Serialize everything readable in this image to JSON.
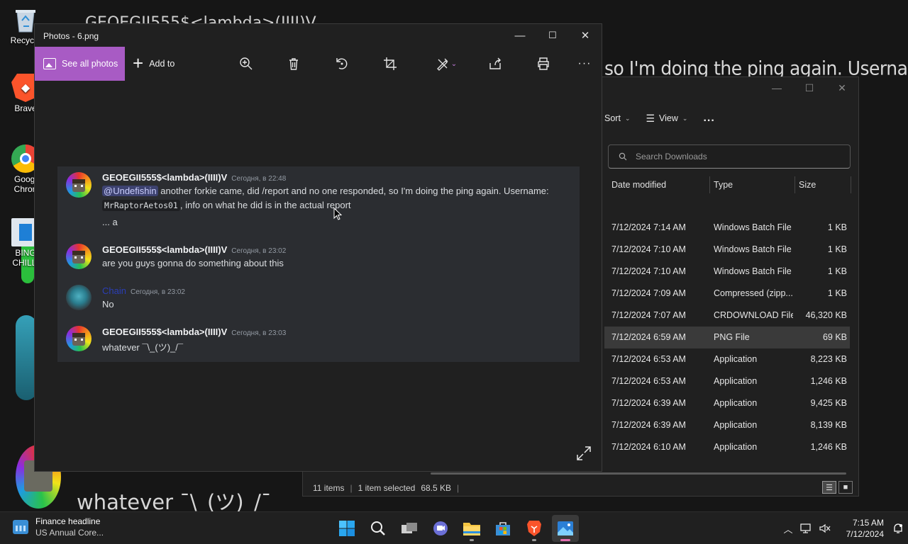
{
  "desktop": {
    "background_texts": {
      "top_fragment": "GEOEGII555$<lambda>(IIII)V",
      "main": "so I'm doing the ping again. Username:",
      "bottom": "whatever ¯\\_(ツ)_/¯"
    },
    "icons": [
      {
        "label": "Recycle",
        "icon": "recycle-bin-icon"
      },
      {
        "label": "Brave",
        "icon": "brave-browser-icon"
      },
      {
        "label": "Google Chrome",
        "label_line1": "Googl",
        "label_line2": "Chron",
        "icon": "chrome-icon"
      },
      {
        "label": "BING CHILLING",
        "label_line1": "BING",
        "label_line2": "CHILLI",
        "icon": "shortcut-icon"
      }
    ]
  },
  "photos": {
    "title": "Photos - 6.png",
    "toolbar": {
      "see_all": "See all photos",
      "add_to": "Add to",
      "zoom": "zoom-in-icon",
      "delete": "trash-icon",
      "rotate": "rotate-icon",
      "crop": "crop-icon",
      "edit": "edit-draw-icon",
      "share": "share-icon",
      "print": "print-icon",
      "more": "more-icon"
    },
    "chat": {
      "messages": [
        {
          "user": "GEOEGII555$<lambda>(IIII)V",
          "time": "Сегодня, в 22:48",
          "mention": "@Undefishin",
          "text1": "another forkie came, did /report and no one responded, so I'm doing the ping again. Username:",
          "code": "MrRaptorAetos01",
          "text2": ", info on what he did is in the actual report",
          "text3": "... a"
        },
        {
          "user": "GEOEGII555$<lambda>(IIII)V",
          "time": "Сегодня, в 23:02",
          "text": "are you guys gonna do something about this"
        },
        {
          "user": "Chain",
          "time": "Сегодня, в 23:02",
          "text": "No"
        },
        {
          "user": "GEOEGII555$<lambda>(IIII)V",
          "time": "Сегодня, в 23:03",
          "text": "whatever ¯\\_(ツ)_/¯"
        }
      ]
    }
  },
  "explorer": {
    "toolbar": {
      "sort": "Sort",
      "view": "View",
      "more": "..."
    },
    "search_placeholder": "Search Downloads",
    "columns": {
      "date": "Date modified",
      "type": "Type",
      "size": "Size"
    },
    "rows": [
      {
        "date": "7/12/2024 7:14 AM",
        "type": "Windows Batch File",
        "size": "1 KB",
        "selected": false
      },
      {
        "date": "7/12/2024 7:10 AM",
        "type": "Windows Batch File",
        "size": "1 KB",
        "selected": false
      },
      {
        "date": "7/12/2024 7:10 AM",
        "type": "Windows Batch File",
        "size": "1 KB",
        "selected": false
      },
      {
        "date": "7/12/2024 7:09 AM",
        "type": "Compressed (zipp...",
        "size": "1 KB",
        "selected": false
      },
      {
        "date": "7/12/2024 7:07 AM",
        "type": "CRDOWNLOAD File",
        "size": "46,320 KB",
        "selected": false
      },
      {
        "date": "7/12/2024 6:59 AM",
        "type": "PNG File",
        "size": "69 KB",
        "selected": true
      },
      {
        "date": "7/12/2024 6:53 AM",
        "type": "Application",
        "size": "8,223 KB",
        "selected": false
      },
      {
        "date": "7/12/2024 6:53 AM",
        "type": "Application",
        "size": "1,246 KB",
        "selected": false
      },
      {
        "date": "7/12/2024 6:39 AM",
        "type": "Application",
        "size": "9,425 KB",
        "selected": false
      },
      {
        "date": "7/12/2024 6:39 AM",
        "type": "Application",
        "size": "8,139 KB",
        "selected": false
      },
      {
        "date": "7/12/2024 6:10 AM",
        "type": "Application",
        "size": "1,246 KB",
        "selected": false
      }
    ],
    "status": {
      "items": "11 items",
      "selected": "1 item selected",
      "size": "68.5 KB"
    }
  },
  "taskbar": {
    "widget_title": "Finance headline",
    "widget_sub": "US Annual Core...",
    "apps": [
      "windows-start-icon",
      "search-icon",
      "task-view-icon",
      "teams-chat-icon",
      "file-explorer-icon",
      "microsoft-store-icon",
      "brave-icon",
      "photos-icon"
    ],
    "time": "7:15 AM",
    "date": "7/12/2024"
  },
  "colors": {
    "accent": "#a85bc4",
    "discord_bg": "#2b2d31",
    "window_bg": "#202020"
  }
}
